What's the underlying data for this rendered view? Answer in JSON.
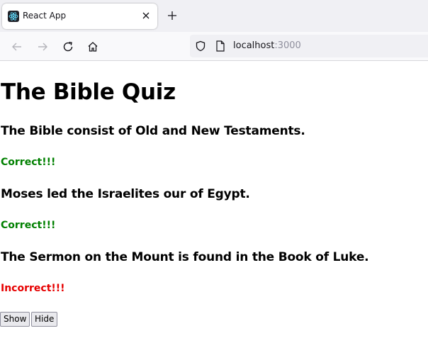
{
  "browser": {
    "tab_title": "React App",
    "url_host": "localhost",
    "url_port": ":3000"
  },
  "page": {
    "title": "The Bible Quiz",
    "questions": [
      {
        "text": "The Bible consist of Old and New Testaments.",
        "result": "Correct!!!",
        "status": "correct"
      },
      {
        "text": "Moses led the Israelites our of Egypt.",
        "result": "Correct!!!",
        "status": "correct"
      },
      {
        "text": "The Sermon on the Mount is found in the Book of Luke.",
        "result": "Incorrect!!!",
        "status": "incorrect"
      }
    ],
    "buttons": {
      "show_label": "Show",
      "hide_label": "Hide"
    }
  },
  "colors": {
    "correct": "#008000",
    "incorrect": "#e60000"
  },
  "icons": [
    "react-logo-icon",
    "close-icon",
    "plus-icon",
    "back-arrow-icon",
    "forward-arrow-icon",
    "reload-icon",
    "home-icon",
    "shield-icon",
    "page-icon"
  ]
}
